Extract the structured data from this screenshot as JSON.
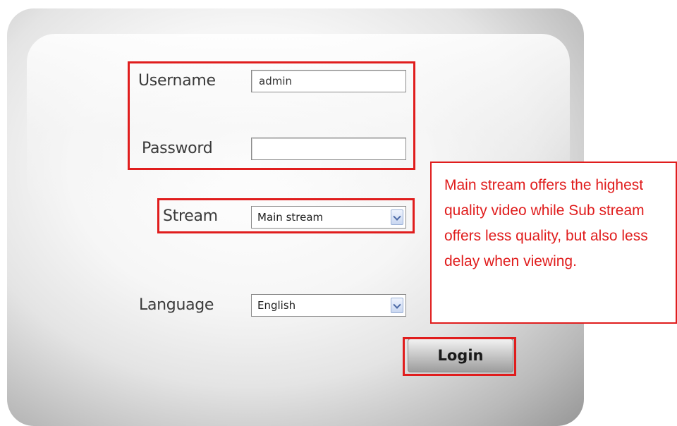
{
  "login_form": {
    "username_label": "Username",
    "username_value": "admin",
    "password_label": "Password",
    "password_value": "",
    "stream_label": "Stream",
    "stream_selected": "Main stream",
    "language_label": "Language",
    "language_selected": "English",
    "login_button": "Login"
  },
  "callout": {
    "text": "Main stream offers the highest quality video while Sub stream offers less quality, but also less delay when viewing."
  },
  "colors": {
    "highlight_red": "#e01d1d"
  }
}
